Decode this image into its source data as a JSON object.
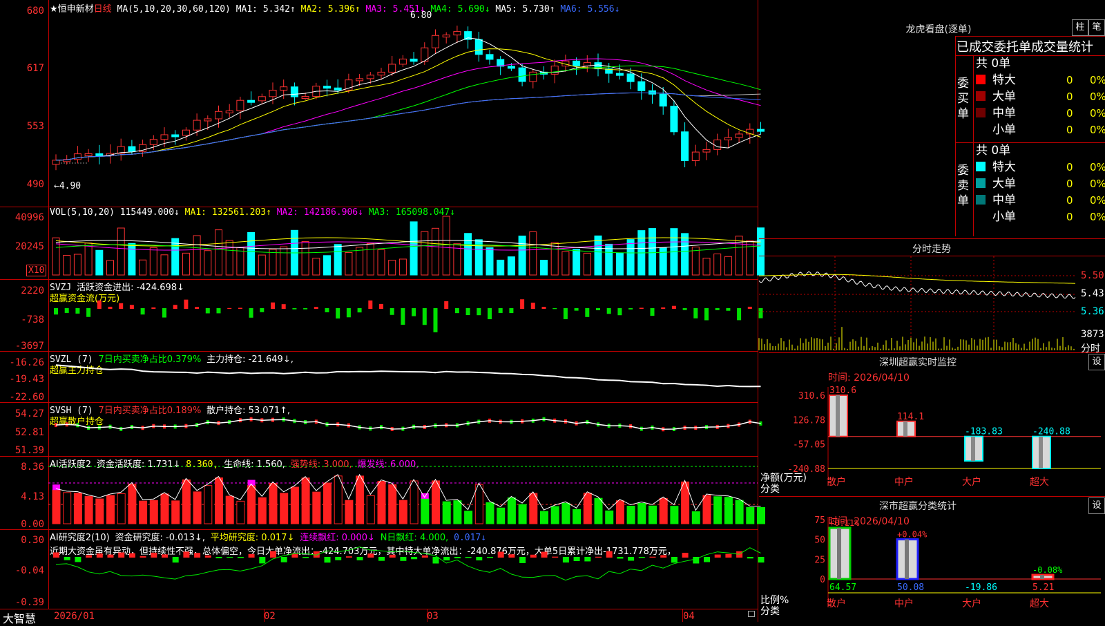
{
  "stock": {
    "title": "★恒申新材",
    "period": "日线",
    "ma_params": "MA(5,10,20,30,60,120)",
    "ma1": "MA1: 5.342↑",
    "ma2": "MA2: 5.396↑",
    "ma3": "MA3: 5.451↓",
    "ma4": "MA4: 5.690↓",
    "ma5": "MA5: 5.730↑",
    "ma6": "MA6: 5.556↓",
    "high_mark": "6.80",
    "low_mark": "←4.90",
    "yticks": [
      "680",
      "617",
      "553",
      "490"
    ]
  },
  "vol": {
    "params": "VOL(5,10,20)",
    "value": "115449.000↓",
    "ma1": "MA1: 132561.203↑",
    "ma2": "MA2: 142186.906↓",
    "ma3": "MA3: 165098.047↓",
    "yticks": [
      "40996",
      "20245"
    ],
    "unit": "X10"
  },
  "svzj": {
    "title": "SVZJ",
    "label": "活跃资金进出: -424.698↓",
    "subtitle": "超赢资金流(万元)",
    "yticks": [
      "2220",
      "-738",
      "-3697"
    ]
  },
  "svzl": {
    "title": "SVZL (7)",
    "ratio": "7日内买卖净占比0.379%",
    "hold": "主力持仓: -21.649↓,",
    "subtitle": "超赢主力持仓",
    "yticks": [
      "-16.26",
      "-19.43",
      "-22.60"
    ]
  },
  "svsh": {
    "title": "SVSH (7)",
    "ratio": "7日内买卖净占比0.189%",
    "hold": "散户持仓: 53.071↑,",
    "subtitle": "超赢散户持仓",
    "yticks": [
      "54.27",
      "52.81",
      "51.39"
    ]
  },
  "ai1": {
    "title": "AI活跃度2",
    "v1": "资金活跃度: 1.731↓",
    "v2": "8.360,",
    "v3": "生命线: 1.560,",
    "v4": "强势线: 3.000,",
    "v5": "爆发线: 6.000,",
    "yticks": [
      "8.36",
      "4.13",
      "0.00"
    ]
  },
  "ai2": {
    "title": "AI研究度2(10)",
    "v1": "资金研究度: -0.013↓,",
    "v2": "平均研究度: 0.017↓",
    "v3": "连续飘红: 0.000↓",
    "v4": "N日飘红: 4.000,",
    "v5": "0.017↓",
    "note": "近期大资金虽有异动，但持续性不强，总体偏空，今日大单净流出：-424.703万元，其中特大单净流出：-240.876万元，大单5日累计净出-1731.778万元，",
    "yticks": [
      "0.30",
      "-0.04",
      "-0.39"
    ]
  },
  "xaxis": {
    "brand": "大智慧",
    "labels": [
      "2026/01",
      "02",
      "03",
      "04"
    ]
  },
  "longhu": {
    "title": "龙虎看盘(逐单)",
    "btn1": "柱",
    "btn2": "笔",
    "header": "已成交委托单成交量统计",
    "buy": {
      "label": "委买单",
      "total": "共 0单",
      "rows": [
        {
          "name": "特大",
          "count": "0",
          "pct": "0%",
          "color": "#ff0000"
        },
        {
          "name": "大单",
          "count": "0",
          "pct": "0%",
          "color": "#a00000"
        },
        {
          "name": "中单",
          "count": "0",
          "pct": "0%",
          "color": "#700000"
        },
        {
          "name": "小单",
          "count": "0",
          "pct": "0%",
          "color": "#000000"
        }
      ]
    },
    "sell": {
      "label": "委卖单",
      "total": "共 0单",
      "rows": [
        {
          "name": "特大",
          "count": "0",
          "pct": "0%",
          "color": "#00ffff"
        },
        {
          "name": "大单",
          "count": "0",
          "pct": "0%",
          "color": "#00a0a0"
        },
        {
          "name": "中单",
          "count": "0",
          "pct": "0%",
          "color": "#007878"
        },
        {
          "name": "小单",
          "count": "0",
          "pct": "0%",
          "color": "#000000"
        }
      ]
    }
  },
  "intraday": {
    "title": "分时走势",
    "prices": [
      "5.50",
      "5.43",
      "5.36"
    ],
    "volume": "3873",
    "volume_label": "分时"
  },
  "sz_monitor": {
    "title": "深圳超赢实时监控",
    "btn": "设",
    "time": "时间: 2026/04/10",
    "yticks": [
      "310.6",
      "126.78",
      "-57.05",
      "-240.88"
    ],
    "ylabel": "净额(万元)",
    "xlabel": "分类",
    "bars": [
      {
        "cat": "散户",
        "value": 310.6,
        "label": "310.6"
      },
      {
        "cat": "中户",
        "value": 114.1,
        "label": "114.1"
      },
      {
        "cat": "大户",
        "value": -183.83,
        "label": "-183.83"
      },
      {
        "cat": "超大",
        "value": -240.88,
        "label": "-240.88"
      }
    ]
  },
  "sh_stats": {
    "title": "深市超赢分类统计",
    "btn": "设",
    "time": "时间: 2026/04/10",
    "yticks": [
      "75",
      "50",
      "25",
      "0"
    ],
    "ylabel": "比例%",
    "xlabel": "分类",
    "bars": [
      {
        "cat": "散户",
        "top": "+0.11%",
        "bottom": "64.57",
        "value": 64.57
      },
      {
        "cat": "中户",
        "top": "+0.04%",
        "bottom": "50.08",
        "value": 50.08
      },
      {
        "cat": "大户",
        "top": "",
        "bottom": "-19.86",
        "value": 0
      },
      {
        "cat": "超大",
        "top": "-0.08%",
        "bottom": "5.21",
        "value": 5.21
      }
    ]
  }
}
